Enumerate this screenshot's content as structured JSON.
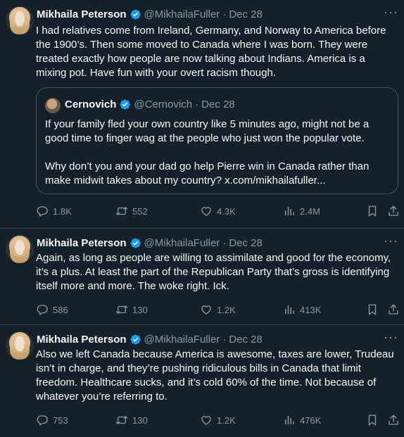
{
  "tweets": [
    {
      "name": "Mikhaila Peterson",
      "handle": "@MikhailaFuller",
      "date": "Dec 28",
      "text": "I had relatives come from Ireland, Germany, and Norway to America before the 1900’s. Then some moved to Canada where I was born. They were treated exactly how people are now talking about Indians. America is a mixing pot. Have fun with your overt racism though.",
      "quote": {
        "name": "Cernovich",
        "handle": "@Cernovich",
        "date": "Dec 28",
        "para1": "If your family fled your own country like 5 minutes ago, might not be a good time to finger wag at the people who just won the popular vote.",
        "para2": "Why don’t you and your dad go help Pierre win in Canada rather than make midwit takes about my country? x.com/mikhailafuller..."
      },
      "replies": "1.8K",
      "reposts": "552",
      "likes": "4.3K",
      "views": "2.4M"
    },
    {
      "name": "Mikhaila Peterson",
      "handle": "@MikhailaFuller",
      "date": "Dec 28",
      "text": "Again, as long as people are willing to assimilate and good for the economy, it’s a plus. At least the part of the Republican Party that’s gross is identifying itself more and more. The woke right. Ick.",
      "replies": "586",
      "reposts": "130",
      "likes": "1.2K",
      "views": "413K"
    },
    {
      "name": "Mikhaila Peterson",
      "handle": "@MikhailaFuller",
      "date": "Dec 28",
      "text": "Also we left Canada because America is awesome, taxes are lower, Trudeau isn’t in charge, and they’re pushing ridiculous bills in Canada that limit freedom. Healthcare sucks, and it’s cold 60% of the time. Not because of whatever you’re referring to.",
      "replies": "753",
      "reposts": "130",
      "likes": "1.2K",
      "views": "476K"
    }
  ],
  "ui": {
    "dot": "·",
    "more": "···"
  },
  "colors": {
    "background": "#15202b",
    "text": "#f7f9f9",
    "muted": "#8b98a5",
    "verified": "#1d9bf0",
    "border": "#38444d"
  },
  "icons": [
    "verified-badge-icon",
    "more-icon",
    "reply-icon",
    "repost-icon",
    "like-icon",
    "views-icon",
    "bookmark-icon",
    "share-icon"
  ]
}
